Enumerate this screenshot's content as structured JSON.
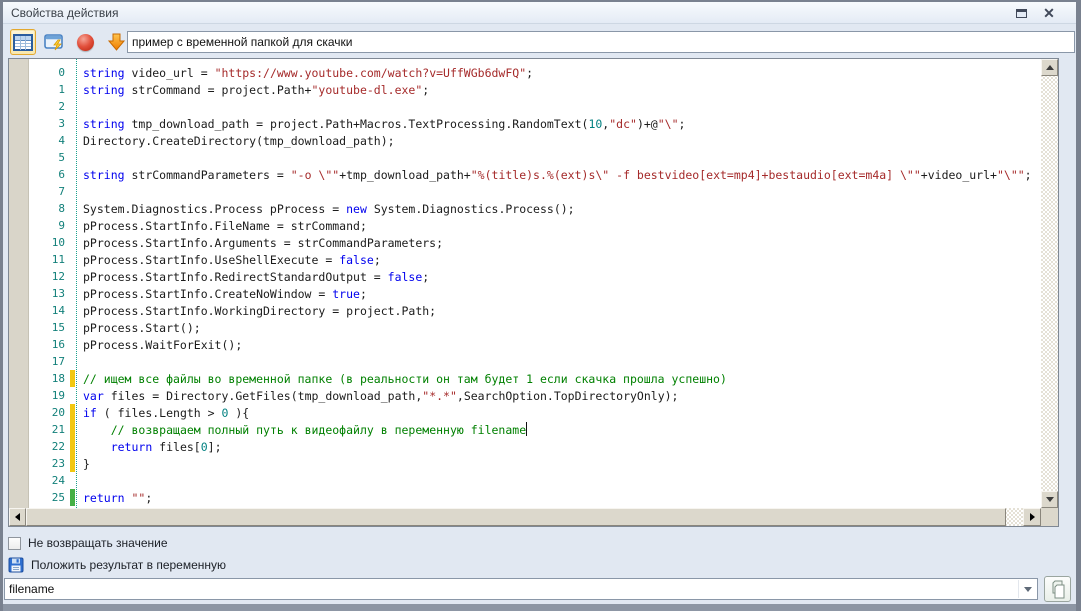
{
  "window": {
    "title": "Свойства действия",
    "maximize_icon": "maximize-icon",
    "close_icon": "close-icon",
    "close_glyph": "✕"
  },
  "toolbar": {
    "buttons": [
      {
        "icon": "table-grid-icon",
        "selected": true
      },
      {
        "icon": "window-lightning-icon",
        "selected": false
      },
      {
        "icon": "record-icon",
        "selected": false
      },
      {
        "icon": "down-arrow-icon",
        "selected": false
      }
    ],
    "action_name_value": "пример с временной папкой для скачки"
  },
  "editor": {
    "colors": {
      "keyword": "#0000ee",
      "string": "#a52a2a",
      "comment": "#008000",
      "number": "#018080",
      "plain": "#1b1b1b",
      "line_number": "#12807a",
      "mark_yellow": "#f2c811",
      "mark_green": "#45b045"
    },
    "lines": [
      {
        "n": 0,
        "seg": [
          [
            "k",
            "string"
          ],
          [
            "t",
            " video_url = "
          ],
          [
            "s",
            "\"https://www.youtube.com/watch?v=UffWGb6dwFQ\""
          ],
          [
            "t",
            ";"
          ]
        ]
      },
      {
        "n": 1,
        "seg": [
          [
            "k",
            "string"
          ],
          [
            "t",
            " strCommand = project.Path+"
          ],
          [
            "s",
            "\"youtube-dl.exe\""
          ],
          [
            "t",
            ";"
          ]
        ]
      },
      {
        "n": 2,
        "seg": []
      },
      {
        "n": 3,
        "seg": [
          [
            "k",
            "string"
          ],
          [
            "t",
            " tmp_download_path = project.Path+Macros.TextProcessing.RandomText("
          ],
          [
            "n2",
            "10"
          ],
          [
            "t",
            ","
          ],
          [
            "s",
            "\"dc\""
          ],
          [
            "t",
            ")+@"
          ],
          [
            "s",
            "\"\\\""
          ],
          [
            "t",
            ";"
          ]
        ]
      },
      {
        "n": 4,
        "seg": [
          [
            "t",
            "Directory.CreateDirectory(tmp_download_path);"
          ]
        ]
      },
      {
        "n": 5,
        "seg": []
      },
      {
        "n": 6,
        "seg": [
          [
            "k",
            "string"
          ],
          [
            "t",
            " strCommandParameters = "
          ],
          [
            "s",
            "\"-o \\\"\""
          ],
          [
            "t",
            "+tmp_download_path+"
          ],
          [
            "s",
            "\"%(title)s.%(ext)s\\\" -f bestvideo[ext=mp4]+bestaudio[ext=m4a] \\\"\""
          ],
          [
            "t",
            "+video_url+"
          ],
          [
            "s",
            "\"\\\"\""
          ],
          [
            "t",
            ";"
          ]
        ]
      },
      {
        "n": 7,
        "seg": []
      },
      {
        "n": 8,
        "seg": [
          [
            "t",
            "System.Diagnostics.Process pProcess = "
          ],
          [
            "k",
            "new"
          ],
          [
            "t",
            " System.Diagnostics.Process();"
          ]
        ]
      },
      {
        "n": 9,
        "seg": [
          [
            "t",
            "pProcess.StartInfo.FileName = strCommand;"
          ]
        ]
      },
      {
        "n": 10,
        "seg": [
          [
            "t",
            "pProcess.StartInfo.Arguments = strCommandParameters;"
          ]
        ]
      },
      {
        "n": 11,
        "seg": [
          [
            "t",
            "pProcess.StartInfo.UseShellExecute = "
          ],
          [
            "k",
            "false"
          ],
          [
            "t",
            ";"
          ]
        ]
      },
      {
        "n": 12,
        "seg": [
          [
            "t",
            "pProcess.StartInfo.RedirectStandardOutput = "
          ],
          [
            "k",
            "false"
          ],
          [
            "t",
            ";"
          ]
        ]
      },
      {
        "n": 13,
        "seg": [
          [
            "t",
            "pProcess.StartInfo.CreateNoWindow = "
          ],
          [
            "k",
            "true"
          ],
          [
            "t",
            ";"
          ]
        ]
      },
      {
        "n": 14,
        "seg": [
          [
            "t",
            "pProcess.StartInfo.WorkingDirectory = project.Path;"
          ]
        ]
      },
      {
        "n": 15,
        "seg": [
          [
            "t",
            "pProcess.Start();"
          ]
        ]
      },
      {
        "n": 16,
        "seg": [
          [
            "t",
            "pProcess.WaitForExit();"
          ]
        ]
      },
      {
        "n": 17,
        "seg": []
      },
      {
        "n": 18,
        "mark": "yellow",
        "seg": [
          [
            "c",
            "// ищем все файлы во временной папке (в реальности он там будет 1 если скачка прошла успешно)"
          ]
        ]
      },
      {
        "n": 19,
        "seg": [
          [
            "k",
            "var"
          ],
          [
            "t",
            " files = Directory.GetFiles(tmp_download_path,"
          ],
          [
            "s",
            "\"*.*\""
          ],
          [
            "t",
            ",SearchOption.TopDirectoryOnly);"
          ]
        ]
      },
      {
        "n": 20,
        "mark": "yellow",
        "seg": [
          [
            "k",
            "if"
          ],
          [
            "t",
            " ( files.Length > "
          ],
          [
            "n2",
            "0"
          ],
          [
            "t",
            " ){"
          ]
        ]
      },
      {
        "n": 21,
        "mark": "yellow",
        "seg": [
          [
            "t",
            "    "
          ],
          [
            "c",
            "// возвращаем полный путь к видеофайлу в переменную filename"
          ],
          [
            "caret",
            ""
          ]
        ]
      },
      {
        "n": 22,
        "mark": "yellow",
        "seg": [
          [
            "t",
            "    "
          ],
          [
            "k",
            "return"
          ],
          [
            "t",
            " files["
          ],
          [
            "n2",
            "0"
          ],
          [
            "t",
            "];"
          ]
        ]
      },
      {
        "n": 23,
        "mark": "yellow",
        "seg": [
          [
            "t",
            "}"
          ]
        ]
      },
      {
        "n": 24,
        "seg": []
      },
      {
        "n": 25,
        "mark": "green",
        "seg": [
          [
            "k",
            "return"
          ],
          [
            "t",
            " "
          ],
          [
            "s",
            "\"\""
          ],
          [
            "t",
            ";"
          ]
        ]
      }
    ]
  },
  "footer": {
    "no_return": {
      "label": "Не возвращать значение",
      "checked": false
    },
    "put_result": {
      "label": "Положить результат в переменную",
      "icon": "floppy-icon"
    },
    "variable_value": "filename",
    "copy_icon": "copy-icon"
  }
}
